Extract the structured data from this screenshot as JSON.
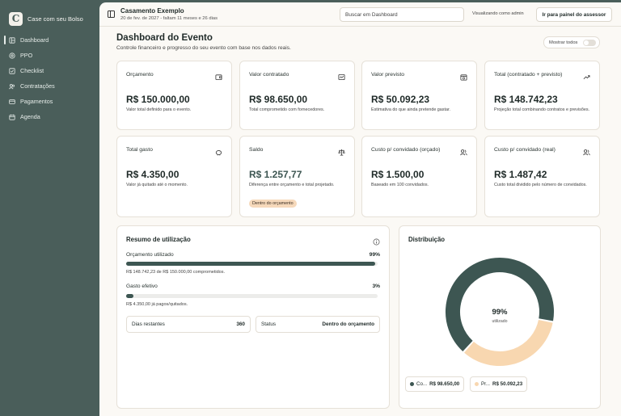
{
  "app": {
    "brand_name": "Case com seu Bolso",
    "brand_initial": "C"
  },
  "sidebar": {
    "items": [
      {
        "label": "Dashboard",
        "icon": "dashboard-icon",
        "active": true
      },
      {
        "label": "PPO",
        "icon": "ppo-icon",
        "active": false
      },
      {
        "label": "Checklist",
        "icon": "checklist-icon",
        "active": false
      },
      {
        "label": "Contratações",
        "icon": "contracts-icon",
        "active": false
      },
      {
        "label": "Pagamentos",
        "icon": "payments-icon",
        "active": false
      },
      {
        "label": "Agenda",
        "icon": "calendar-icon",
        "active": false
      }
    ]
  },
  "header": {
    "event_title": "Casamento Exemplo",
    "event_subtitle": "20 de fev. de 2027 - faltam 11 meses e 26 dias",
    "search_placeholder": "Buscar em Dashboard",
    "viewing_as": "Visualizando como admin",
    "advisor_button": "Ir para painel do assessor"
  },
  "page": {
    "title": "Dashboard do Evento",
    "subtitle": "Controle financeiro e progresso do seu evento com base nos dados reais.",
    "show_all_label": "Mostrar todos",
    "show_all_on": false
  },
  "cards": [
    {
      "label": "Orçamento",
      "value": "R$ 150.000,00",
      "desc": "Valor total definido para o evento.",
      "icon": "wallet-icon"
    },
    {
      "label": "Valor contratado",
      "value": "R$ 98.650,00",
      "desc": "Total comprometido com fornecedores.",
      "icon": "contract-icon"
    },
    {
      "label": "Valor previsto",
      "value": "R$ 50.092,23",
      "desc": "Estimativa do que ainda pretende gastar.",
      "icon": "calendar-clock-icon"
    },
    {
      "label": "Total (contratado + previsto)",
      "value": "R$ 148.742,23",
      "desc": "Projeção total combinando contratos e previsões.",
      "icon": "trend-up-icon"
    },
    {
      "label": "Total gasto",
      "value": "R$ 4.350,00",
      "desc": "Valor já quitado até o momento.",
      "icon": "piggy-bank-icon"
    },
    {
      "label": "Saldo",
      "value": "R$ 1.257,77",
      "desc": "Diferença entre orçamento e total projetado.",
      "icon": "scale-icon",
      "chip": "Dentro do orçamento"
    },
    {
      "label": "Custo p/ convidado (orçado)",
      "value": "R$ 1.500,00",
      "desc": "Baseado em 100 convidados.",
      "icon": "users-icon"
    },
    {
      "label": "Custo p/ convidado (real)",
      "value": "R$ 1.487,42",
      "desc": "Custo total dividido pelo número de convidados.",
      "icon": "users-icon"
    }
  ],
  "usage": {
    "title": "Resumo de utilização",
    "budget_used_label": "Orçamento utilizado",
    "budget_used_pct_text": "99%",
    "budget_used_fraction": 0.99,
    "budget_used_note": "R$ 148.742,23 de R$ 150.000,00 comprometidos.",
    "spent_label": "Gasto efetivo",
    "spent_pct_text": "3%",
    "spent_fraction": 0.03,
    "spent_note": "R$ 4.350,00 já pagos/quitados.",
    "days_left_label": "Dias restantes",
    "days_left_value": "360",
    "status_label": "Status",
    "status_value": "Dentro do orçamento"
  },
  "distribution": {
    "title": "Distribuição",
    "center_pct": "99%",
    "center_label": "utilizado",
    "colors": {
      "contracted": "#3d5652",
      "forecast": "#f8d7b0"
    },
    "legend": [
      {
        "short": "Co...",
        "value": "R$ 98.650,00",
        "amount": 98650.0,
        "color": "#3d5652"
      },
      {
        "short": "Pr...",
        "value": "R$ 50.092,23",
        "amount": 50092.23,
        "color": "#f8d7b0"
      }
    ]
  }
}
